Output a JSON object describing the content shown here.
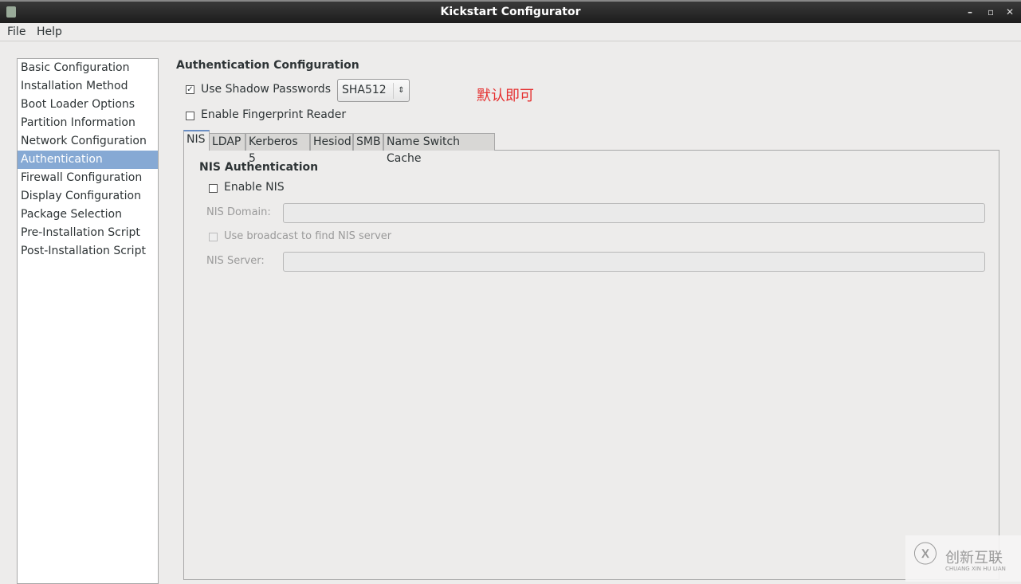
{
  "window": {
    "title": "Kickstart Configurator",
    "minimize": "–",
    "maximize": "▫",
    "close": "✕"
  },
  "menu": [
    "File",
    "Help"
  ],
  "sidebar": {
    "items": [
      "Basic Configuration",
      "Installation Method",
      "Boot Loader Options",
      "Partition Information",
      "Network Configuration",
      "Authentication",
      "Firewall Configuration",
      "Display Configuration",
      "Package Selection",
      "Pre-Installation Script",
      "Post-Installation Script"
    ],
    "selected": "Authentication"
  },
  "auth": {
    "heading": "Authentication Configuration",
    "shadow_label": "Use Shadow Passwords",
    "shadow_checked": true,
    "hash_value": "SHA512",
    "fingerprint_label": "Enable Fingerprint Reader",
    "fingerprint_checked": false,
    "annotation": "默认即可"
  },
  "tabs": [
    "NIS",
    "LDAP",
    "Kerberos 5",
    "Hesiod",
    "SMB",
    "Name Switch Cache"
  ],
  "nis": {
    "heading": "NIS Authentication",
    "enable_label": "Enable NIS",
    "domain_label": "NIS Domain:",
    "domain_value": "",
    "broadcast_label": "Use broadcast to find NIS server",
    "server_label": "NIS Server:",
    "server_value": ""
  },
  "watermark": {
    "text": "创新互联",
    "sub": "CHUANG XIN HU LIAN"
  }
}
